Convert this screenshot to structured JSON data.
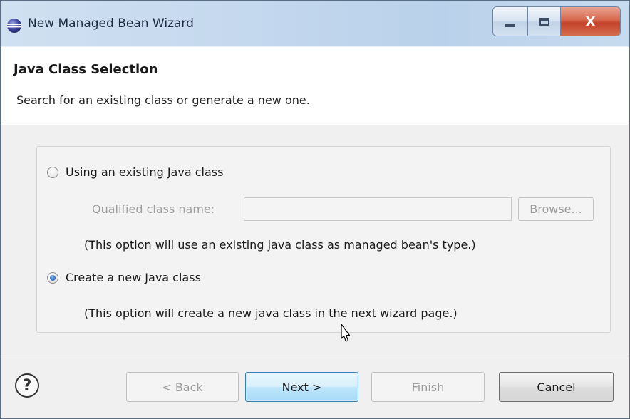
{
  "window": {
    "title": "New Managed Bean Wizard",
    "controls": {
      "minimize_icon": "minimize-icon",
      "maximize_icon": "maximize-icon",
      "close_glyph": "X"
    }
  },
  "header": {
    "title": "Java Class Selection",
    "description": "Search for an existing class or generate a new one."
  },
  "options": {
    "existing": {
      "label": "Using an existing Java class",
      "selected": false,
      "qualified_label": "Qualified class name:",
      "qualified_value": "",
      "browse_label": "Browse...",
      "note": "(This option will use an existing java class as managed bean's type.)"
    },
    "create": {
      "label": "Create a new Java class",
      "selected": true,
      "note": "(This option will create a new java class in the next wizard page.)"
    }
  },
  "buttons": {
    "help_glyph": "?",
    "back": "< Back",
    "next": "Next >",
    "finish": "Finish",
    "cancel": "Cancel"
  },
  "colors": {
    "titlebar": "#c4d8ee",
    "close_button": "#c3432a",
    "primary_button_border": "#3c7fb1"
  }
}
